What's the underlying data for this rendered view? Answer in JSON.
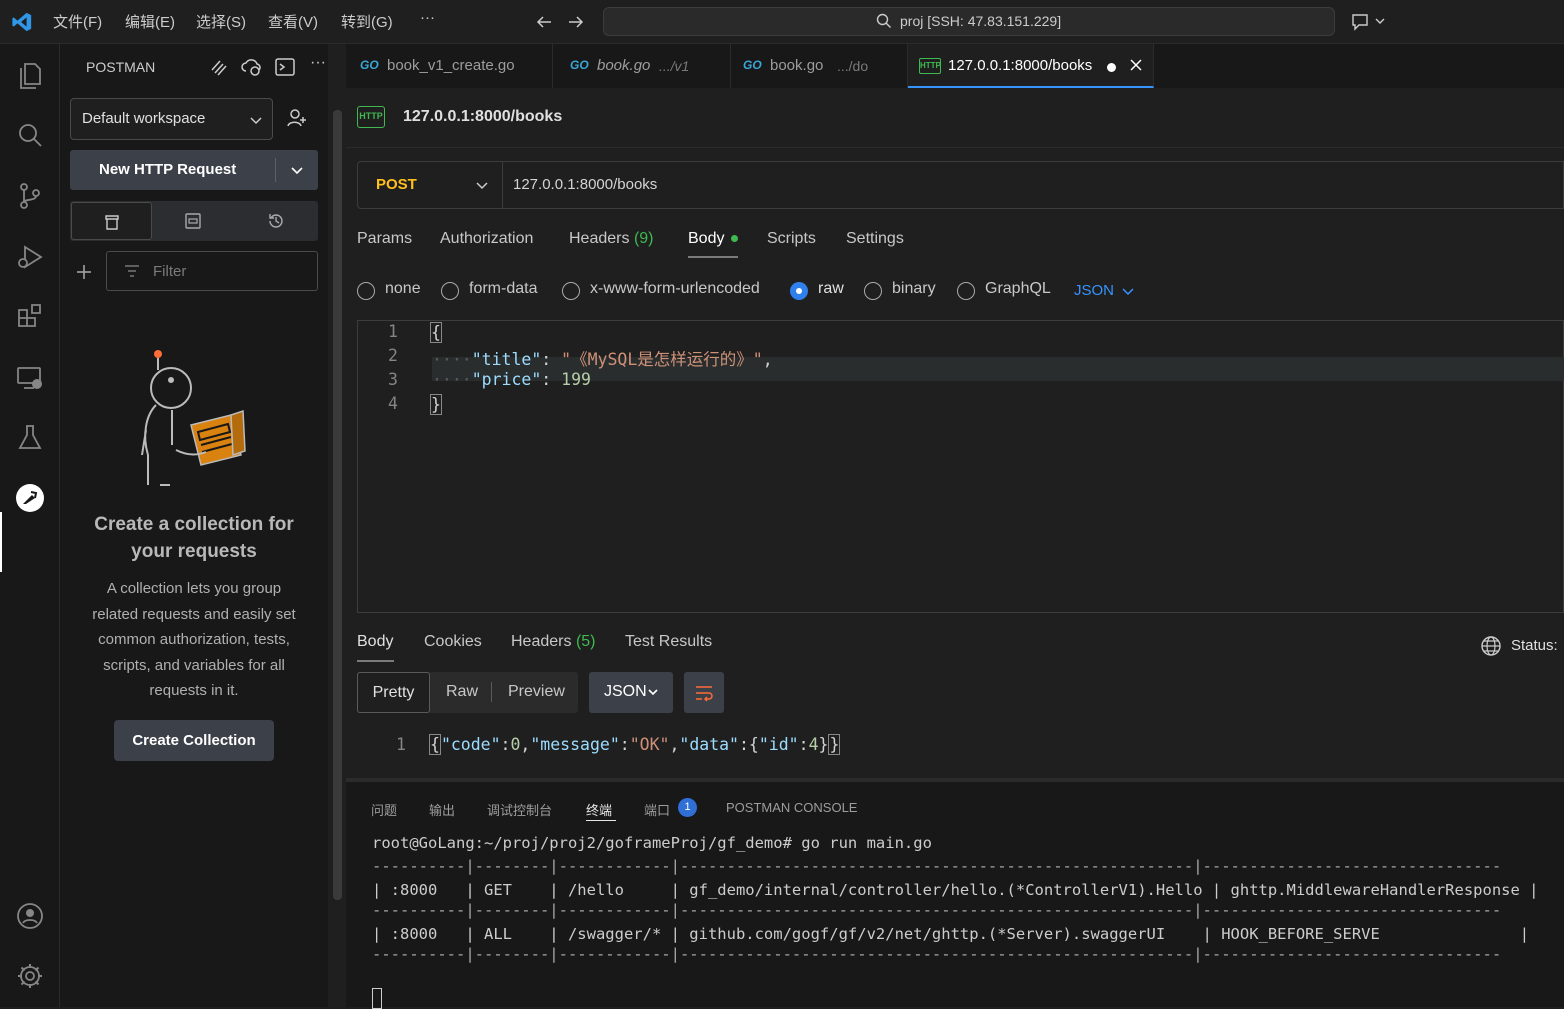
{
  "titlebar": {
    "menus": [
      "文件(F)",
      "编辑(E)",
      "选择(S)",
      "查看(V)",
      "转到(G)",
      "···"
    ],
    "command_center": "proj [SSH: 47.83.151.229]"
  },
  "sidebar": {
    "title": "POSTMAN",
    "workspace": "Default workspace",
    "new_request": "New HTTP Request",
    "filter_placeholder": "Filter",
    "empty_title_line1": "Create a collection for",
    "empty_title_line2": "your requests",
    "empty_desc": [
      "A collection lets you group",
      "related requests and easily set",
      "common authorization, tests,",
      "scripts, and variables for all",
      "requests in it."
    ],
    "create_collection": "Create Collection"
  },
  "tabs": [
    {
      "prefix": "GO",
      "label": "book_v1_create.go",
      "suffix": "",
      "italic": false
    },
    {
      "prefix": "GO",
      "label": "book.go",
      "suffix": ".../v1",
      "italic": true
    },
    {
      "prefix": "GO",
      "label": "book.go",
      "suffix": ".../do",
      "italic": false
    },
    {
      "prefix": "HTTP",
      "label": "127.0.0.1:8000/books",
      "suffix": "",
      "italic": false
    }
  ],
  "request": {
    "title": "127.0.0.1:8000/books",
    "method": "POST",
    "url": "127.0.0.1:8000/books",
    "tabs": [
      "Params",
      "Authorization",
      "Headers",
      "Body",
      "Scripts",
      "Settings"
    ],
    "headers_count": "(9)",
    "body_types": [
      "none",
      "form-data",
      "x-www-form-urlencoded",
      "raw",
      "binary",
      "GraphQL"
    ],
    "selected_body_type": "raw",
    "raw_format": "JSON",
    "body_lines": [
      {
        "n": "1",
        "text": "{"
      },
      {
        "n": "2",
        "key": "\"title\"",
        "value": "\"《MySQL是怎样运行的》\""
      },
      {
        "n": "3",
        "key": "\"price\"",
        "value": "199"
      },
      {
        "n": "4",
        "text": "}"
      }
    ]
  },
  "response": {
    "tabs": [
      "Body",
      "Cookies",
      "Headers",
      "Test Results"
    ],
    "headers_count": "(5)",
    "status_label": "Status:",
    "views": [
      "Pretty",
      "Raw",
      "Preview"
    ],
    "format": "JSON",
    "line_no": "1",
    "body": {
      "k1": "\"code\"",
      "v1": "0",
      "k2": "\"message\"",
      "v2": "\"OK\"",
      "k3": "\"data\"",
      "k4": "\"id\"",
      "v4": "4"
    }
  },
  "panel": {
    "tabs": [
      "问题",
      "输出",
      "调试控制台",
      "终端",
      "端口",
      "POSTMAN CONSOLE"
    ],
    "ports_badge": "1",
    "terminal": [
      "root@GoLang:~/proj/proj2/goframeProj/gf_demo# go run main.go",
      "----------|--------|------------|-------------------------------------------------------|--------------------------------",
      "| :8000   | GET    | /hello     | gf_demo/internal/controller/hello.(*ControllerV1).Hello | ghttp.MiddlewareHandlerResponse |",
      "----------|--------|------------|-------------------------------------------------------|--------------------------------",
      "| :8000   | ALL    | /swagger/* | github.com/gogf/gf/v2/net/ghttp.(*Server).swaggerUI    | HOOK_BEFORE_SERVE               |",
      "----------|--------|------------|-------------------------------------------------------|--------------------------------"
    ]
  },
  "colors": {
    "accent": "#3794ff",
    "method_post": "#ffc01d",
    "json_key": "#9cdcfe",
    "json_string": "#ce9178",
    "json_number": "#b5cea8",
    "body_dot": "#3fb950"
  }
}
